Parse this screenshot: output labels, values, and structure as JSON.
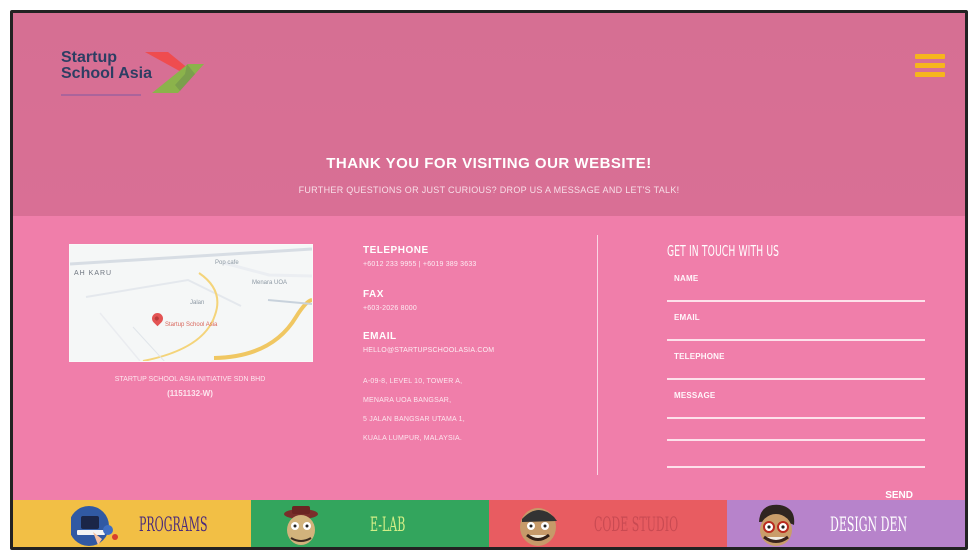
{
  "brand": {
    "name_line1": "Startup",
    "name_line2": "School Asia",
    "colors": {
      "hero_pink": "#d96f95",
      "contact_pink": "#f07eaa",
      "logo_red": "#ef4c4f",
      "logo_green": "#8bb34b",
      "menu_orange": "#f6b51d"
    }
  },
  "header": {
    "menu_icon": "hamburger-menu-icon",
    "title": "THANK YOU FOR VISITING OUR WEBSITE!",
    "subtitle": "FURTHER QUESTIONS OR JUST CURIOUS? DROP US A MESSAGE AND LET'S TALK!"
  },
  "contact": {
    "company": "STARTUP SCHOOL ASIA INITIATIVE SDN BHD",
    "company_id": "(1151132-W)",
    "telephone_label": "TELEPHONE",
    "telephone_value": "+6012 233 9955   |   +6019 389 3633",
    "fax_label": "FAX",
    "fax_value": "+603-2026 8000",
    "email_label": "EMAIL",
    "email_value": "HELLO@STARTUPSCHOOLASIA.COM",
    "address": [
      "A-09-8, LEVEL 10, TOWER A,",
      "MENARA UOA BANGSAR,",
      "5 JALAN BANGSAR UTAMA 1,",
      "KUALA LUMPUR, MALAYSIA."
    ],
    "map": {
      "place_label": "Startup School Asia",
      "labels": [
        "AH KARU",
        "Pop cafe",
        "Jalan",
        "Menara UOA"
      ]
    }
  },
  "form": {
    "title": "GET IN TOUCH WITH US",
    "fields": [
      {
        "label": "NAME"
      },
      {
        "label": "EMAIL"
      },
      {
        "label": "TELEPHONE"
      },
      {
        "label": "MESSAGE"
      }
    ],
    "send_label": "SEND"
  },
  "footer_nav": [
    {
      "label": "PROGRAMS",
      "icon": "laptop-character-icon"
    },
    {
      "label": "E-LAB",
      "icon": "hat-character-icon"
    },
    {
      "label": "CODE STUDIO",
      "icon": "cap-character-icon"
    },
    {
      "label": "DESIGN DEN",
      "icon": "hair-character-icon"
    }
  ]
}
